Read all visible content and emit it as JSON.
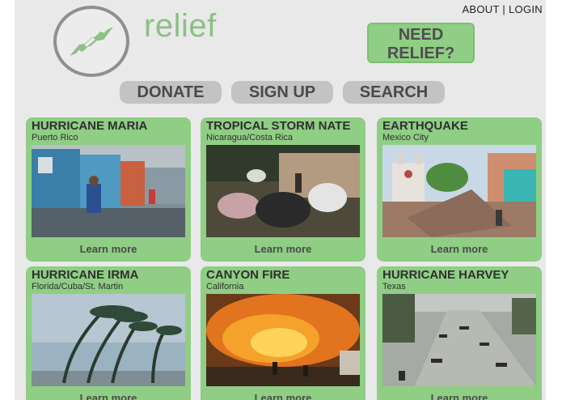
{
  "header": {
    "logo_text": "relief",
    "about": "ABOUT",
    "separator": "|",
    "login": "LOGIN",
    "need_relief": "NEED RELIEF?"
  },
  "nav": {
    "donate": "DONATE",
    "sign_up": "SIGN UP",
    "search": "SEARCH"
  },
  "cards": [
    {
      "title": "HURRICANE MARIA",
      "subtitle": "Puerto Rico",
      "link": "Learn more"
    },
    {
      "title": "TROPICAL STORM NATE",
      "subtitle": "Nicaragua/Costa Rica",
      "link": "Learn more"
    },
    {
      "title": "EARTHQUAKE",
      "subtitle": "Mexico City",
      "link": "Learn more"
    },
    {
      "title": "HURRICANE IRMA",
      "subtitle": "Florida/Cuba/St. Martin",
      "link": "Learn more"
    },
    {
      "title": "CANYON FIRE",
      "subtitle": "California",
      "link": "Learn more"
    },
    {
      "title": "HURRICANE HARVEY",
      "subtitle": "Texas",
      "link": "Learn more"
    }
  ],
  "colors": {
    "accent_green": "#8fce84",
    "logo_green": "#8cc084",
    "button_gray": "#c3c3c3",
    "background": "#e9e9e9"
  }
}
